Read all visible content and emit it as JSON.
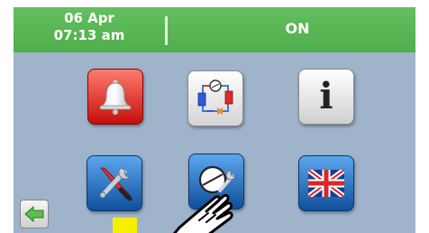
{
  "header": {
    "date": "06 Apr",
    "time": "07:13 am",
    "status": "ON"
  },
  "menu": {
    "items": [
      {
        "name": "alarm",
        "icon": "bell-icon"
      },
      {
        "name": "refrigeration-circuit",
        "icon": "refrigeration-circuit-icon"
      },
      {
        "name": "info",
        "icon": "info-icon",
        "label": "i"
      },
      {
        "name": "settings-tools",
        "icon": "screwdriver-wrench-icon"
      },
      {
        "name": "service",
        "icon": "compressor-wrench-icon"
      },
      {
        "name": "language",
        "icon": "uk-flag-icon"
      }
    ]
  },
  "footer": {
    "back_icon": "arrow-left-icon"
  },
  "colors": {
    "header_green": "#57b453",
    "background": "#9fb3ca",
    "alarm_red": "#d8231c",
    "tile_blue": "#1e6cc4",
    "marker_yellow": "#f6f000"
  }
}
